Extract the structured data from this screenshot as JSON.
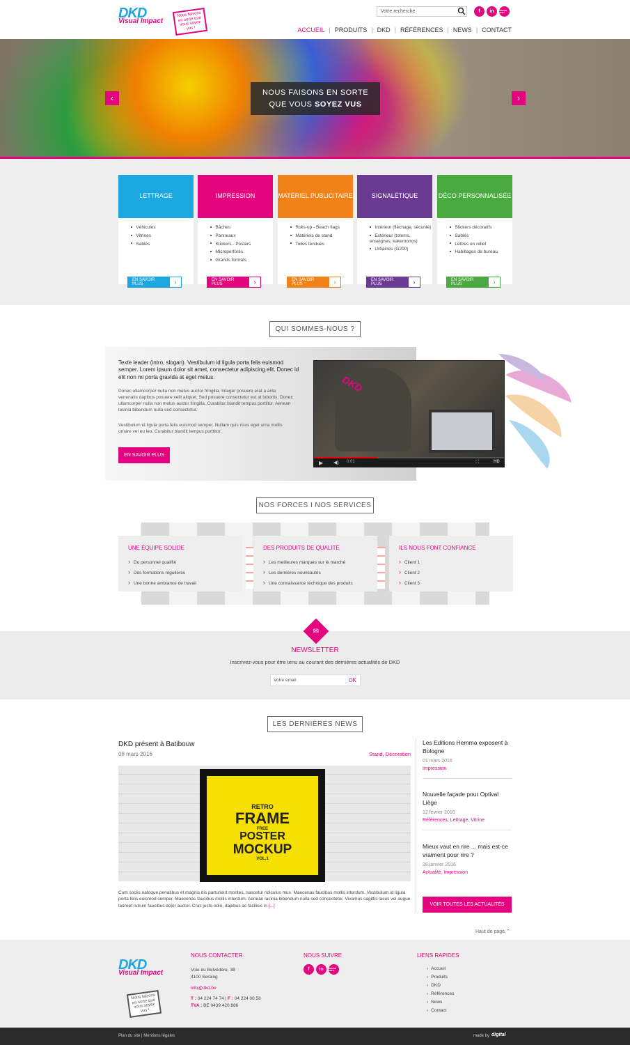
{
  "brand": {
    "logo": "DKD",
    "logo_sub": "Visual Impact",
    "tagline": "Nous faisons en sorte que vous soyez vus !",
    "pink": "#e4047e"
  },
  "header": {
    "search_placeholder": "Votre recherche",
    "nav": [
      "ACCUEIL",
      "PRODUITS",
      "DKD",
      "RÉFÉRENCES",
      "NEWS",
      "CONTACT"
    ],
    "social": [
      {
        "icon": "facebook-icon",
        "label": "f"
      },
      {
        "icon": "linkedin-icon",
        "label": "in"
      },
      {
        "icon": "dream-badge-icon",
        "label": "DREAM ONLY"
      }
    ]
  },
  "hero": {
    "line1": "NOUS FAISONS EN SORTE",
    "line2_pre": "QUE VOUS ",
    "line2_bold": "SOYEZ VUS",
    "prev": "‹",
    "next": "›"
  },
  "cards": [
    {
      "title": "LETTRAGE",
      "color": "#1da7e0",
      "items": [
        "Véhicules",
        "Vitrines",
        "Sablés"
      ],
      "btn": "EN SAVOIR PLUS"
    },
    {
      "title": "IMPRESSION",
      "color": "#e4047e",
      "items": [
        "Bâches",
        "Panneaux",
        "Stickers - Posters",
        "Microperforés",
        "Grands formats"
      ],
      "btn": "EN SAVOIR PLUS"
    },
    {
      "title": "MATÉRIEL PUBLICITAIRE",
      "color": "#f08219",
      "items": [
        "Rolls-up - Beach flags",
        "Matériels de stand",
        "Toiles tendues"
      ],
      "btn": "EN SAVOIR PLUS"
    },
    {
      "title": "SIGNALÉTIQUE",
      "color": "#6b3a92",
      "items": [
        "Intérieur (fléchage, sécurité)",
        "Extérieur (totems, enseignes, kakemonos)",
        "Urbaines (G200)"
      ],
      "btn": "EN SAVOIR PLUS"
    },
    {
      "title": "DÉCO PERSONNALISÉE",
      "color": "#4aa941",
      "items": [
        "Stickers décoratifs",
        "Sablés",
        "Lettres en relief",
        "Habillages de bureau"
      ],
      "btn": "EN SAVOIR PLUS"
    }
  ],
  "about": {
    "title": "QUI SOMMES-NOUS ?",
    "lead": "Texte leader (intro, slogan). Vestibulum id ligula porta felis euismod semper. Lorem ipsum dolor sit amet, consectetur adipiscing elit. Donec id elit non mi porta gravida at eget metus.",
    "p1": "Donec ullamcorper nulla non metus auctor fringilla. Integer posuere erat a ante venenatis dapibus posuere velit aliquet. Sed posuere consectetur est at lobortis. Donec ullamcorper nulla non metus auctor fringilla. Curabitur blandit tempus porttitor. Aenean lacinia bibendum nulla sed consectetur.",
    "p2": "Vestibulum id ligula porta felis euismod semper. Nullam quis risus eget urna mollis ornare vel eu leo. Curabitur blandit tempus porttitor.",
    "btn": "EN SAVOIR PLUS",
    "video_time": "0:01",
    "video_hd": "HD",
    "video_progress": 0.33
  },
  "forces": {
    "title": "NOS FORCES I NOS SERVICES",
    "cols": [
      {
        "title": "UNE ÉQUIPE SOLIDE",
        "items": [
          "Du personnel qualifié",
          "Des formations régulières",
          "Une bonne ambiance de travail"
        ]
      },
      {
        "title": "DES PRODUITS DE QUALITÉ",
        "items": [
          "Les meilleures marques sur le marché",
          "Les dernières nouveautés",
          "Une connaissance technique des produits"
        ]
      },
      {
        "title": "ILS NOUS FONT CONFIANCE",
        "items": [
          "Client 1",
          "Client 2",
          "Client 3"
        ]
      }
    ]
  },
  "newsletter": {
    "title": "NEWSLETTER",
    "text": "Inscrivez-vous pour être tenu au courant des dernières actualités de DKD",
    "placeholder": "Votre email",
    "ok": "OK"
  },
  "news": {
    "title": "LES DERNIÈRES NEWS",
    "main": {
      "title": "DKD présent à Batibouw",
      "date": "08 mars 2016",
      "tags": "Stand, Décoration",
      "poster": [
        "RETRO",
        "FRAME",
        "FREE",
        "POSTER",
        "MOCKUP",
        "VOL.1"
      ],
      "text": "Cum sociis natoque penatibus et magnis dis parturient montes, nascetur ridiculus mus. Maecenas faucibus mollis interdum. Vestibulum id ligula porta felis euismod semper. Maecenas faucibus mollis interdum. Aenean lacinia bibendum nulla sed consectetur. Vivamus sagittis lacus vel augue laoreet rutrum faucibus dolor auctor. Cras justo odio, dapibus ac facilisis in",
      "more": "[...]"
    },
    "side": [
      {
        "title": "Les Editions Hemma exposent à Bologne",
        "date": "01 mars 2016",
        "tags": "Impression"
      },
      {
        "title": "Nouvelle façade pour Optival Liège",
        "date": "12 février 2016",
        "tags": "Références, Lettrage, Vitrine"
      },
      {
        "title": "Mieux vaut en rire ... mais est-ce vraiment pour rire ?",
        "date": "28 janvier 2016",
        "tags": "Actualité, Impression"
      }
    ],
    "all_btn": "VOIR TOUTES LES ACTUALITÉS"
  },
  "top_link": "Haut de page",
  "footer": {
    "contact_title": "NOUS CONTACTER",
    "address1": "Voie du Belvédère, 3B",
    "address2": "4100 Seraing",
    "email": "info@dkd.be",
    "tel_label": "T :",
    "tel": "04 224 74 74",
    "fax_label": "F :",
    "fax": "04 224 00 58",
    "tva_label": "TVA :",
    "tva": "BE 0439.420.886",
    "follow_title": "NOUS SUIVRE",
    "links_title": "LIENS RAPIDES",
    "links": [
      "Accueil",
      "Produits",
      "DKD",
      "Références",
      "News",
      "Contact"
    ],
    "bottom_left": "Plan du site | Mentions légales",
    "made_by": "made by",
    "agency": "digital"
  }
}
